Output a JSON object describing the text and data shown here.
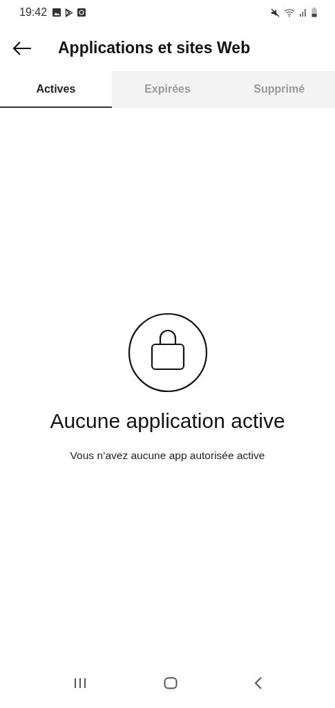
{
  "status_bar": {
    "time": "19:42"
  },
  "header": {
    "title": "Applications et sites Web"
  },
  "tabs": [
    {
      "label": "Actives",
      "selected": true
    },
    {
      "label": "Expirées",
      "selected": false
    },
    {
      "label": "Supprimé",
      "selected": false
    }
  ],
  "empty_state": {
    "title": "Aucune application active",
    "message": "Vous n’avez aucune app autorisée active"
  }
}
